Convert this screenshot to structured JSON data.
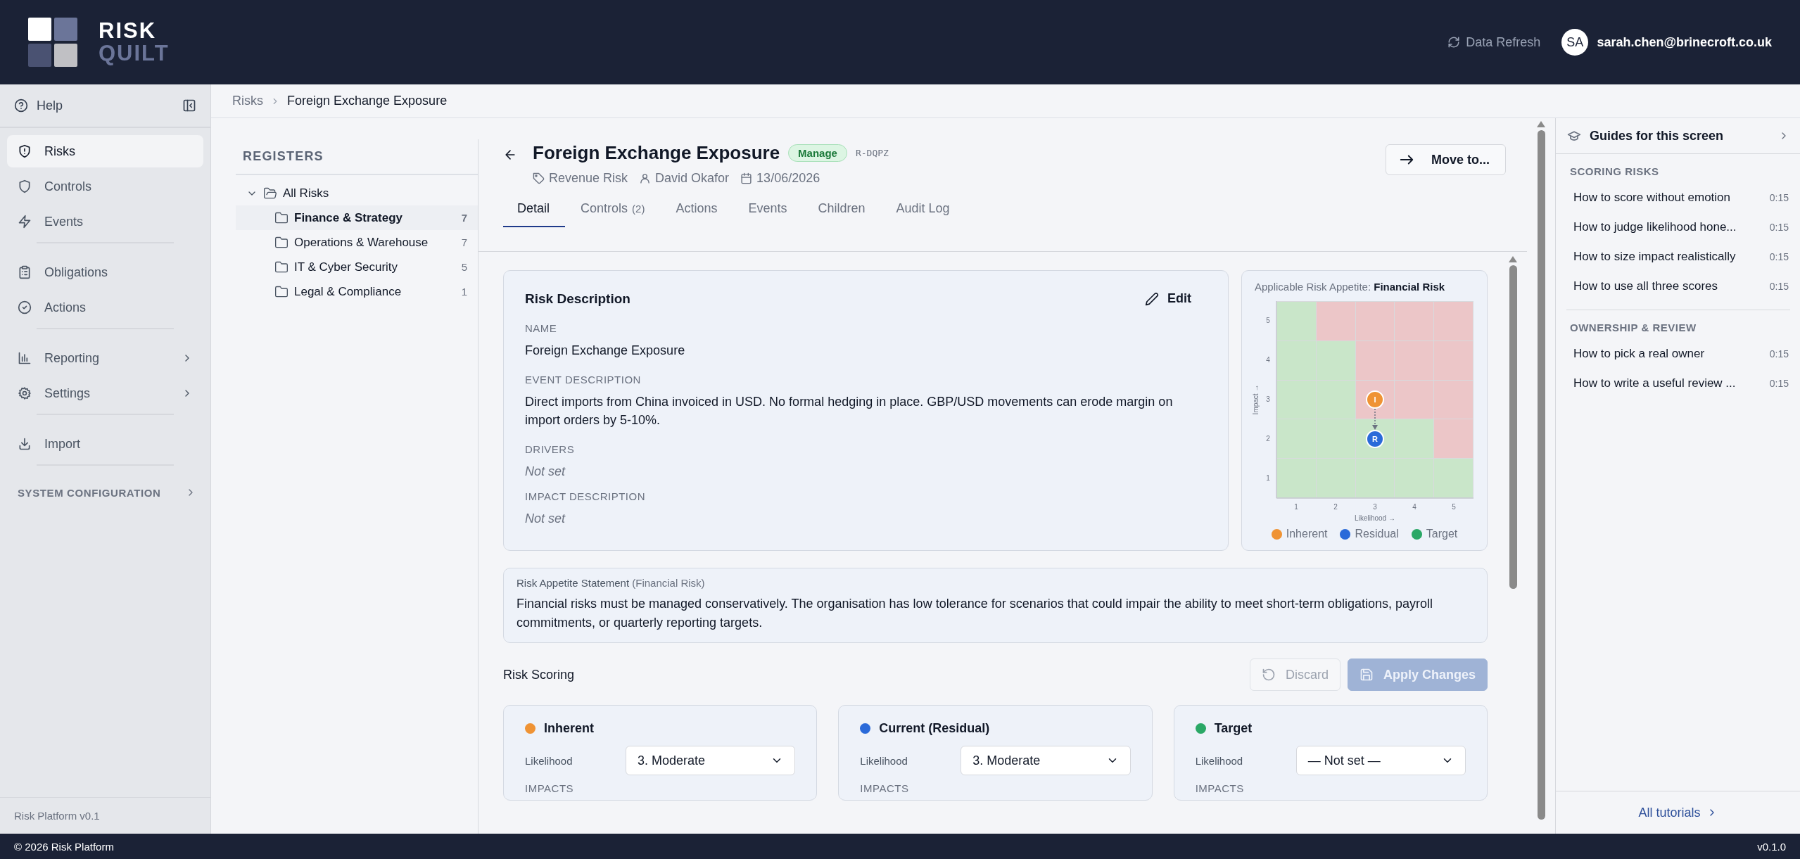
{
  "header": {
    "logo": {
      "line_1": "RISK",
      "line_2": "QUILT"
    },
    "refresh": "Data Refresh",
    "user": {
      "initials": "SA",
      "email": "sarah.chen@brinecroft.co.uk"
    }
  },
  "sidebar": {
    "help": "Help",
    "groups": [
      [
        {
          "label": "Risks",
          "selected": true,
          "submenu": false
        },
        {
          "label": "Controls",
          "selected": false,
          "submenu": false
        },
        {
          "label": "Events",
          "selected": false,
          "submenu": false
        }
      ],
      [
        {
          "label": "Obligations",
          "selected": false,
          "submenu": false
        },
        {
          "label": "Actions",
          "selected": false,
          "submenu": false
        }
      ],
      [
        {
          "label": "Reporting",
          "selected": false,
          "submenu": true
        },
        {
          "label": "Settings",
          "selected": false,
          "submenu": true
        }
      ],
      [
        {
          "label": "Import",
          "selected": false,
          "submenu": false
        }
      ]
    ],
    "section": {
      "label": "SYSTEM CONFIGURATION",
      "submenu": true
    },
    "version": "Risk Platform v0.1"
  },
  "breadcrumb": [
    "Risks",
    "Foreign Exchange Exposure"
  ],
  "registers": {
    "title": "REGISTERS",
    "tree": [
      {
        "label": "All Risks",
        "expanded": true,
        "selected": false,
        "children": [
          {
            "label": "Finance & Strategy",
            "count": "7",
            "selected": true
          },
          {
            "label": "Operations & Warehouse",
            "count": "7",
            "selected": false
          },
          {
            "label": "IT & Cyber Security",
            "count": "5",
            "selected": false
          },
          {
            "label": "Legal & Compliance",
            "count": "1",
            "selected": false
          }
        ]
      }
    ]
  },
  "risk": {
    "title": "Foreign Exchange Exposure",
    "badge": "Manage",
    "code": "R-DQPZ",
    "category": "Revenue Risk",
    "owner": "David Okafor",
    "date": "13/06/2026",
    "move_button": "Move to...",
    "tabs": [
      {
        "label": "Detail",
        "selected": true
      },
      {
        "label": "Controls",
        "count": "(2)",
        "selected": false
      },
      {
        "label": "Actions",
        "selected": false
      },
      {
        "label": "Events",
        "selected": false
      },
      {
        "label": "Children",
        "selected": false
      },
      {
        "label": "Audit Log",
        "selected": false
      }
    ],
    "description": {
      "title": "Risk Description",
      "edit": "Edit",
      "fields": [
        {
          "label": "NAME",
          "value": "Foreign Exchange Exposure",
          "set": true
        },
        {
          "label": "EVENT DESCRIPTION",
          "value": "Direct imports from China invoiced in USD. No formal hedging in place. GBP/USD movements can erode margin on import orders by 5-10%.",
          "set": true
        },
        {
          "label": "DRIVERS",
          "value": "Not set",
          "set": false
        },
        {
          "label": "IMPACT DESCRIPTION",
          "value": "Not set",
          "set": false
        }
      ]
    },
    "appetite": {
      "caption": "Applicable Risk Appetite:",
      "name": "Financial Risk",
      "exceeded": [
        [
          false,
          true,
          true,
          true,
          true
        ],
        [
          false,
          false,
          true,
          true,
          true
        ],
        [
          false,
          false,
          true,
          true,
          true
        ],
        [
          false,
          false,
          false,
          false,
          true
        ],
        [
          false,
          false,
          false,
          false,
          false
        ]
      ],
      "chart_data": {
        "type": "scatter",
        "xlabel": "Likelihood →",
        "ylabel": "Impact →",
        "xlim": [
          0.5,
          5.5
        ],
        "ylim": [
          0.5,
          5.5
        ],
        "xticks": [
          {
            "value": 1,
            "label": "1"
          },
          {
            "value": 2,
            "label": "2"
          },
          {
            "value": 3,
            "label": "3"
          },
          {
            "value": 4,
            "label": "4"
          },
          {
            "value": 5,
            "label": "5"
          }
        ],
        "yticks": [
          {
            "value": 1,
            "label": "1"
          },
          {
            "value": 2,
            "label": "2"
          },
          {
            "value": 3,
            "label": "3"
          },
          {
            "value": 4,
            "label": "4"
          },
          {
            "value": 5,
            "label": "5"
          }
        ],
        "x": [
          3
        ],
        "series": [
          {
            "name": "Inherent",
            "color": "#ef9334",
            "values": [
              3
            ]
          },
          {
            "name": "Residual",
            "color": "#2a6ad9",
            "values": [
              2
            ]
          },
          {
            "name": "Target",
            "color": "#2aa866",
            "values": [
              null
            ]
          }
        ],
        "annotations": [
          {
            "x": 3,
            "y": 3,
            "text": "I"
          },
          {
            "x": 3,
            "y": 2,
            "text": "R"
          }
        ]
      }
    },
    "statement": {
      "label": "Risk Appetite Statement",
      "qualifier": "(Financial Risk)",
      "text": "Financial risks must be managed conservatively. The organisation has low tolerance for scenarios that could impair the ability to meet short-term obligations, payroll commitments, or quarterly reporting targets."
    },
    "scoring": {
      "title": "Risk Scoring",
      "discard": {
        "label": "Discard",
        "disabled": true
      },
      "apply": {
        "label": "Apply Changes",
        "disabled": true
      },
      "cards": [
        {
          "title": "Inherent",
          "color": "#ef9334",
          "likelihood_label": "Likelihood",
          "likelihood": "3. Moderate",
          "impacts_label": "IMPACTS"
        },
        {
          "title": "Current (Residual)",
          "color": "#2a6ad9",
          "likelihood_label": "Likelihood",
          "likelihood": "3. Moderate",
          "impacts_label": "IMPACTS"
        },
        {
          "title": "Target",
          "color": "#2aa866",
          "likelihood_label": "Likelihood",
          "likelihood": "— Not set —",
          "impacts_label": "IMPACTS"
        }
      ]
    }
  },
  "guides": {
    "title": "Guides for this screen",
    "sections": [
      {
        "title": "SCORING RISKS",
        "items": [
          {
            "title": "How to score without emotion",
            "duration": "0:15"
          },
          {
            "title": "How to judge likelihood hone...",
            "duration": "0:15"
          },
          {
            "title": "How to size impact realistically",
            "duration": "0:15"
          },
          {
            "title": "How to use all three scores",
            "duration": "0:15"
          }
        ]
      },
      {
        "title": "OWNERSHIP & REVIEW",
        "items": [
          {
            "title": "How to pick a real owner",
            "duration": "0:15"
          },
          {
            "title": "How to write a useful review ...",
            "duration": "0:15"
          }
        ]
      }
    ],
    "footer_link": "All tutorials"
  },
  "footer": {
    "copyright": "© 2026 Risk Platform",
    "version": "v0.1.0"
  }
}
